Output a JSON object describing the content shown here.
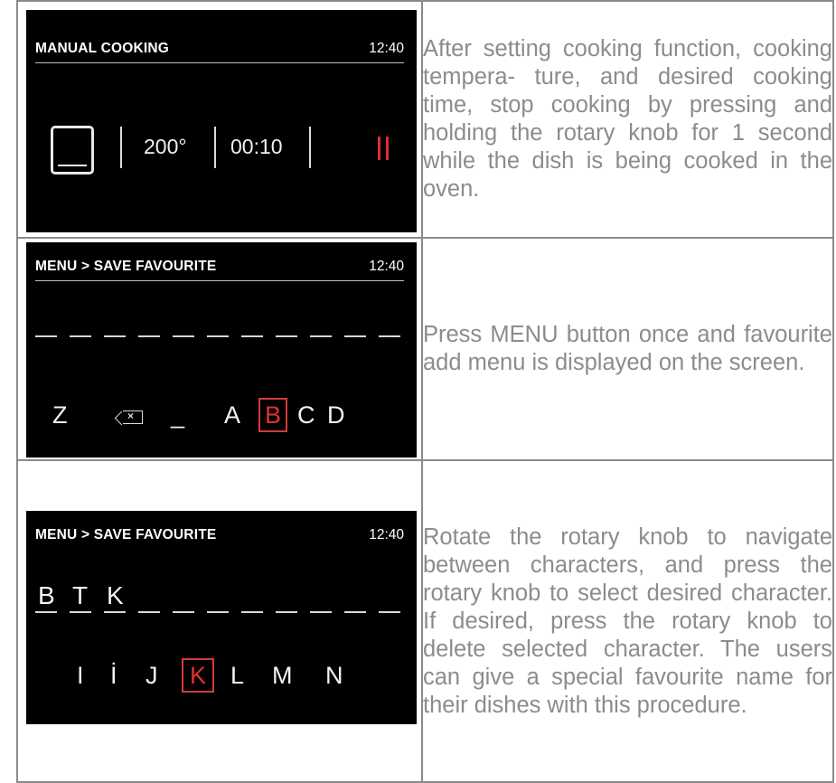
{
  "rows": [
    {
      "screen": {
        "title": "MANUAL COOKING",
        "time": "12:40",
        "function_icon": "oven-conventional-icon",
        "temperature": "200°",
        "duration": "00:10",
        "status_icon": "pause-icon",
        "accent_color": "#e02a2a"
      },
      "description": "After setting cooking function, cooking tempera- ture, and desired cooking time, stop cooking by pressing and holding the rotary knob for 1 second while the dish is being cooked in the oven."
    },
    {
      "screen": {
        "title": "MENU > SAVE FAVOURITE",
        "time": "12:40",
        "characters": [
          "Z",
          "⌫",
          "_",
          "A",
          "B",
          "C",
          "D"
        ],
        "selected": "B"
      },
      "description": "Press MENU button once and favourite add menu is displayed on the screen."
    },
    {
      "screen": {
        "title": "MENU > SAVE FAVOURITE",
        "time": "12:40",
        "entered": [
          "B",
          "T",
          "K"
        ],
        "characters": [
          "I",
          "İ",
          "J",
          "K",
          "L",
          "M",
          "N"
        ],
        "selected": "K"
      },
      "description": "Rotate the rotary knob to navigate between characters, and press the rotary knob to select desired character. If desired, press the rotary knob to delete selected character. The users can give a special favourite name for their dishes with this procedure."
    }
  ]
}
